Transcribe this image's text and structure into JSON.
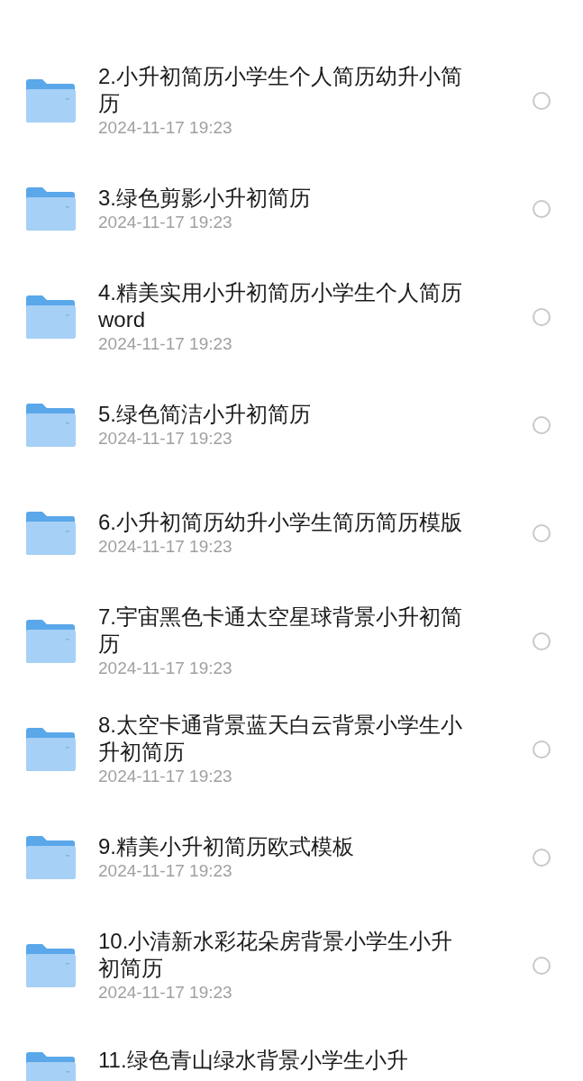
{
  "files": [
    {
      "title": "2.小升初简历小学生个人简历幼升小简历",
      "date": "2024-11-17 19:23",
      "selected": false
    },
    {
      "title": "3.绿色剪影小升初简历",
      "date": "2024-11-17 19:23",
      "selected": false
    },
    {
      "title": "4.精美实用小升初简历小学生个人简历word",
      "date": "2024-11-17 19:23",
      "selected": false
    },
    {
      "title": "5.绿色简洁小升初简历",
      "date": "2024-11-17 19:23",
      "selected": false
    },
    {
      "title": "6.小升初简历幼升小学生简历简历模版",
      "date": "2024-11-17 19:23",
      "selected": false
    },
    {
      "title": "7.宇宙黑色卡通太空星球背景小升初简历",
      "date": "2024-11-17 19:23",
      "selected": false
    },
    {
      "title": "8.太空卡通背景蓝天白云背景小学生小升初简历",
      "date": "2024-11-17 19:23",
      "selected": false
    },
    {
      "title": "9.精美小升初简历欧式模板",
      "date": "2024-11-17 19:23",
      "selected": false
    },
    {
      "title": "10.小清新水彩花朵房背景小学生小升初简历",
      "date": "2024-11-17 19:23",
      "selected": false
    },
    {
      "title": "11.绿色青山绿水背景小学生小升"
    }
  ]
}
